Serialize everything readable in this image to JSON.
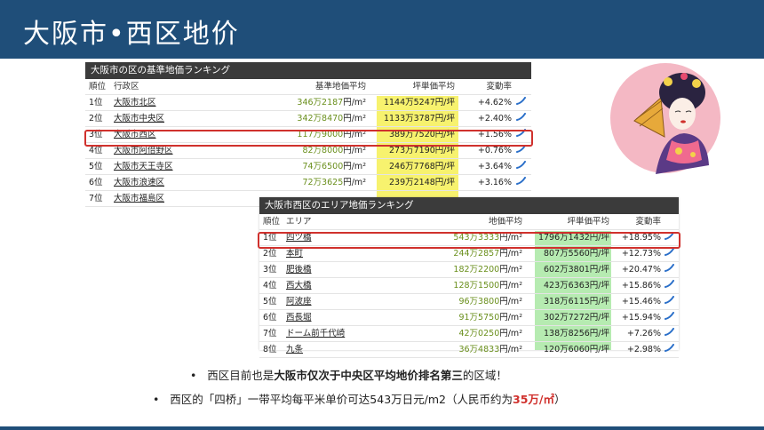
{
  "slide": {
    "title": "大阪市•西区地价"
  },
  "table1": {
    "caption": "大阪市の区の基準地価ランキング",
    "headers": {
      "rank": "順位",
      "name": "行政区",
      "price": "基準地価平均",
      "tsubo": "坪単価平均",
      "rate": "変動率"
    },
    "rows": [
      {
        "rank": "1位",
        "name": "大阪市北区",
        "price": "346万2187",
        "unit": "円/m²",
        "tsubo": "1144万5247円/坪",
        "rate": "+4.62%"
      },
      {
        "rank": "2位",
        "name": "大阪市中央区",
        "price": "342万8470",
        "unit": "円/m²",
        "tsubo": "1133万3787円/坪",
        "rate": "+2.40%"
      },
      {
        "rank": "3位",
        "name": "大阪市西区",
        "price": "117万9000",
        "unit": "円/m²",
        "tsubo": "389万7520円/坪",
        "rate": "+1.56%"
      },
      {
        "rank": "4位",
        "name": "大阪市阿倍野区",
        "price": "82万8000",
        "unit": "円/m²",
        "tsubo": "273万7190円/坪",
        "rate": "+0.76%"
      },
      {
        "rank": "5位",
        "name": "大阪市天王寺区",
        "price": "74万6500",
        "unit": "円/m²",
        "tsubo": "246万7768円/坪",
        "rate": "+3.64%"
      },
      {
        "rank": "6位",
        "name": "大阪市浪速区",
        "price": "72万3625",
        "unit": "円/m²",
        "tsubo": "239万2148円/坪",
        "rate": "+3.16%"
      },
      {
        "rank": "7位",
        "name": "大阪市福島区",
        "price": "",
        "unit": "",
        "tsubo": "",
        "rate": ""
      }
    ]
  },
  "table2": {
    "caption": "大阪市西区のエリア地価ランキング",
    "headers": {
      "rank": "順位",
      "name": "エリア",
      "price": "地価平均",
      "tsubo": "坪単価平均",
      "rate": "変動率"
    },
    "rows": [
      {
        "rank": "1位",
        "name": "四ツ橋",
        "price": "543万3333",
        "unit": "円/m²",
        "tsubo": "1796万1432円/坪",
        "rate": "+18.95%"
      },
      {
        "rank": "2位",
        "name": "本町",
        "price": "244万2857",
        "unit": "円/m²",
        "tsubo": "807万5560円/坪",
        "rate": "+12.73%"
      },
      {
        "rank": "3位",
        "name": "肥後橋",
        "price": "182万2200",
        "unit": "円/m²",
        "tsubo": "602万3801円/坪",
        "rate": "+20.47%"
      },
      {
        "rank": "4位",
        "name": "西大橋",
        "price": "128万1500",
        "unit": "円/m²",
        "tsubo": "423万6363円/坪",
        "rate": "+15.86%"
      },
      {
        "rank": "5位",
        "name": "阿波座",
        "price": "96万3800",
        "unit": "円/m²",
        "tsubo": "318万6115円/坪",
        "rate": "+15.46%"
      },
      {
        "rank": "6位",
        "name": "西長堀",
        "price": "91万5750",
        "unit": "円/m²",
        "tsubo": "302万7272円/坪",
        "rate": "+15.94%"
      },
      {
        "rank": "7位",
        "name": "ドーム前千代崎",
        "price": "42万0250",
        "unit": "円/m²",
        "tsubo": "138万8256円/坪",
        "rate": "+7.26%"
      },
      {
        "rank": "8位",
        "name": "九条",
        "price": "36万4833",
        "unit": "円/m²",
        "tsubo": "120万6060円/坪",
        "rate": "+2.98%"
      }
    ]
  },
  "bullets": {
    "b1": {
      "pre": "西区目前也是",
      "bold": "大阪市仅次于中央区平均地价排名第三",
      "post": "的区域！"
    },
    "b2": {
      "pre": "西区的「四桥」一带平均每平米单价可达543万日元/m2（人民币约为",
      "red": "35万/㎡",
      "post": "）"
    }
  },
  "colors": {
    "header_bg": "#1f4e79",
    "highlight_yellow": "#f7f26e",
    "highlight_green": "#b6ebb1",
    "red_box": "#d0312d",
    "price_green": "#6a8f1c"
  }
}
